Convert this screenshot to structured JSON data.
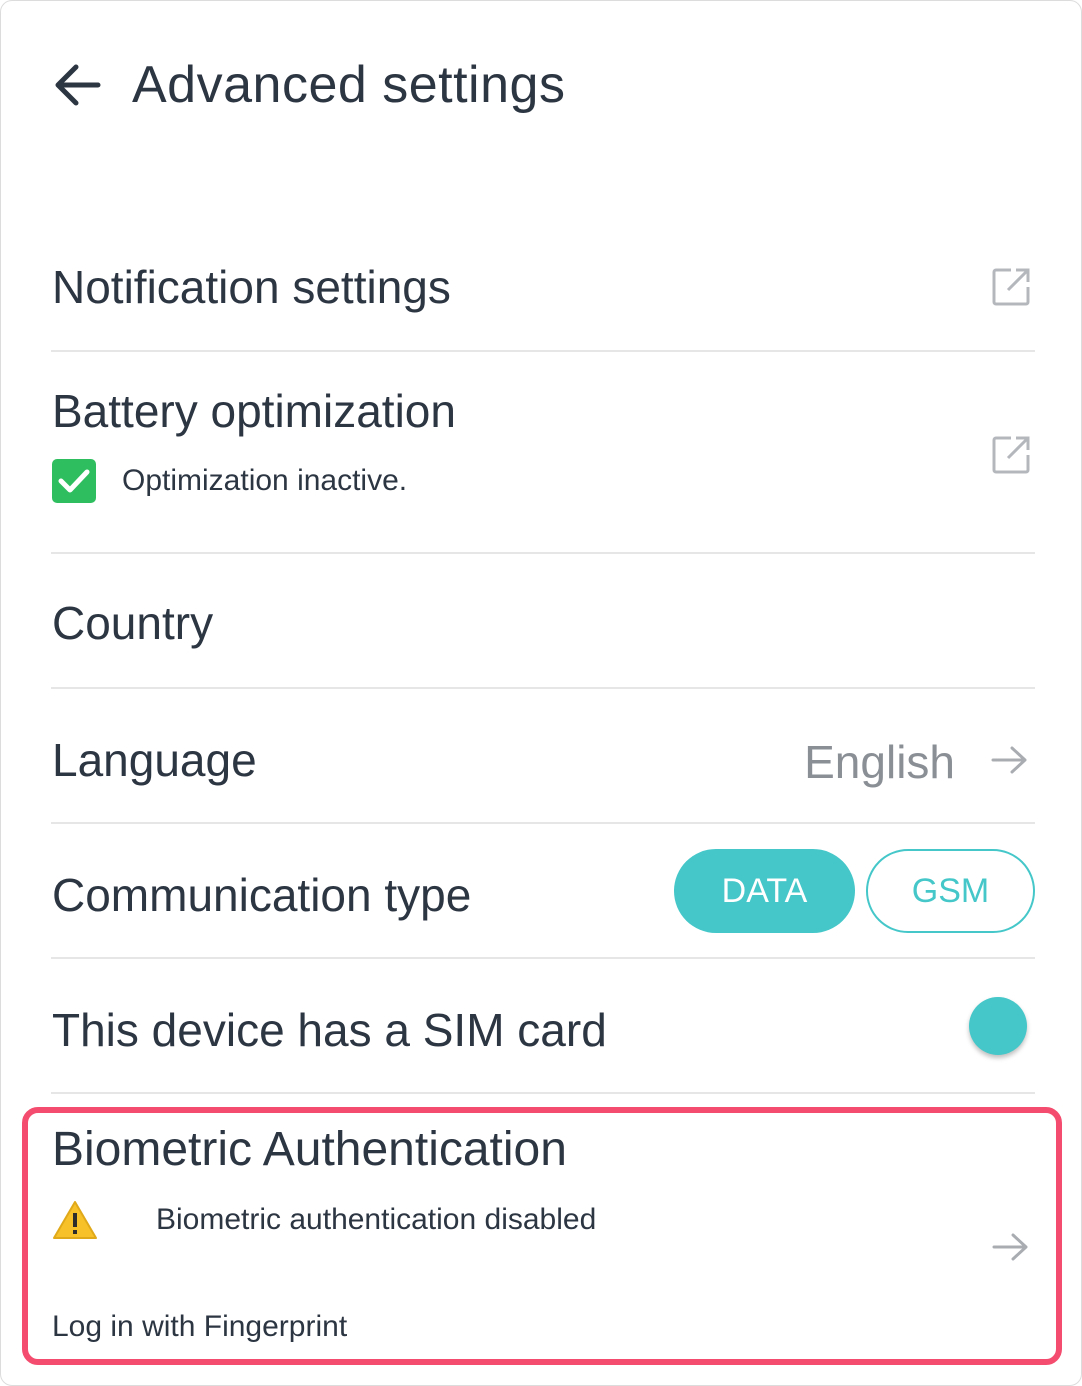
{
  "header": {
    "title": "Advanced settings",
    "back_icon": "arrow-left-icon"
  },
  "notification": {
    "title": "Notification settings",
    "icon": "external-link-icon"
  },
  "battery": {
    "title": "Battery optimization",
    "status": "Optimization inactive.",
    "status_icon": "check-box-icon",
    "icon": "external-link-icon"
  },
  "country": {
    "title": "Country"
  },
  "language": {
    "title": "Language",
    "value": "English",
    "icon": "arrow-right-icon"
  },
  "communication": {
    "title": "Communication type",
    "options": [
      "DATA",
      "GSM"
    ],
    "selected": "DATA"
  },
  "sim": {
    "title": "This device has a SIM card",
    "toggle_on": true
  },
  "biometric": {
    "title": "Biometric Authentication",
    "status": "Biometric authentication disabled",
    "status_icon": "warning-icon",
    "subtitle": "Log in with Fingerprint",
    "icon": "arrow-right-icon"
  },
  "colors": {
    "accent": "#45c7c9",
    "highlight": "#f44c6e",
    "text": "#2c3542",
    "muted": "#8a8f96",
    "divider": "#e6e6e6",
    "check_green": "#2fbe5f",
    "warning_yellow": "#f7c12a"
  }
}
